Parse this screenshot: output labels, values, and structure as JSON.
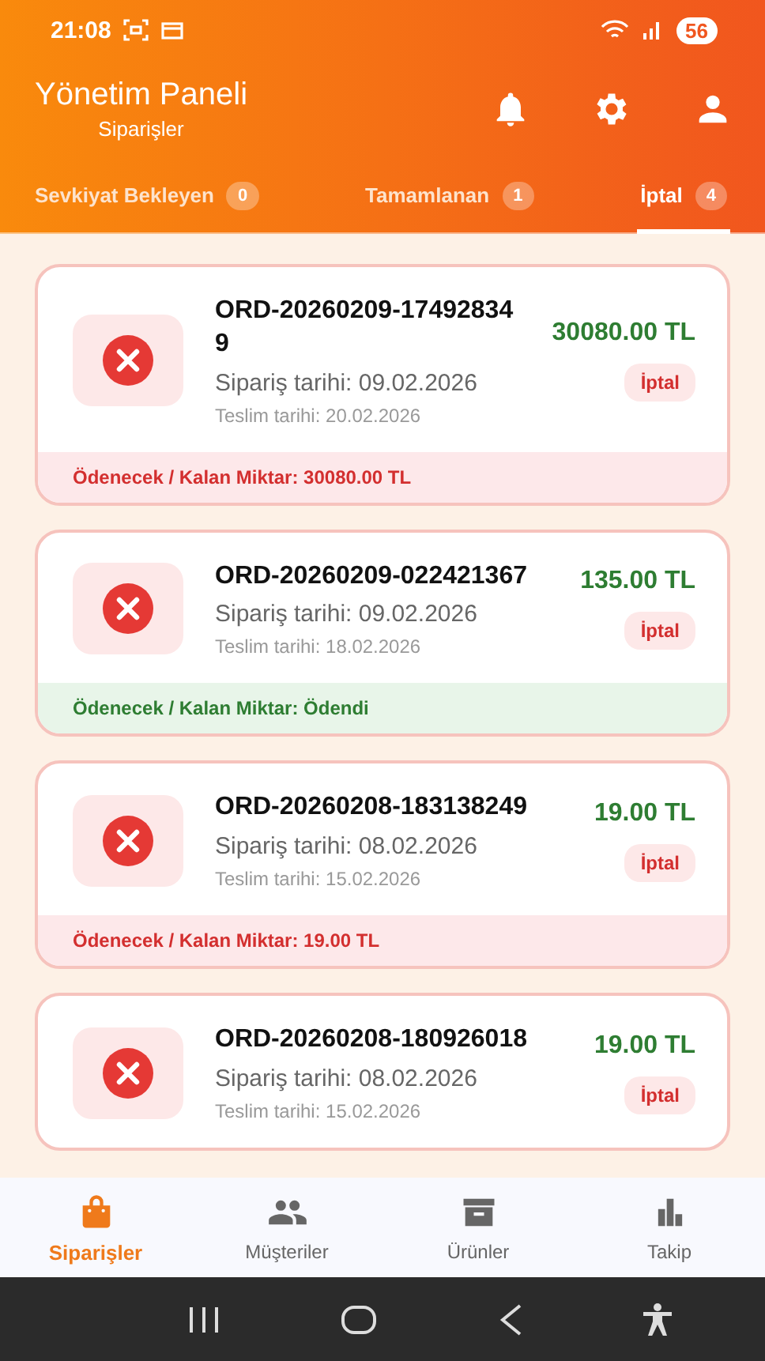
{
  "status_bar": {
    "time": "21:08",
    "battery": "56"
  },
  "header": {
    "title": "Yönetim Paneli",
    "subtitle": "Siparişler"
  },
  "tabs": [
    {
      "label": "Sevkiyat Bekleyen",
      "count": "0",
      "selected": false
    },
    {
      "label": "Tamamlanan",
      "count": "1",
      "selected": false
    },
    {
      "label": "İptal",
      "count": "4",
      "selected": true
    }
  ],
  "orders": [
    {
      "id": "ORD-20260209-174928349",
      "amount": "30080.00 TL",
      "status": "İptal",
      "order_date": "Sipariş tarihi: 09.02.2026",
      "delivery_date": "Teslim tarihi: 20.02.2026",
      "balance": "Ödenecek / Kalan Miktar: 30080.00 TL",
      "paid": false
    },
    {
      "id": "ORD-20260209-022421367",
      "amount": "135.00 TL",
      "status": "İptal",
      "order_date": "Sipariş tarihi: 09.02.2026",
      "delivery_date": "Teslim tarihi: 18.02.2026",
      "balance": "Ödenecek / Kalan Miktar: Ödendi",
      "paid": true
    },
    {
      "id": "ORD-20260208-183138249",
      "amount": "19.00 TL",
      "status": "İptal",
      "order_date": "Sipariş tarihi: 08.02.2026",
      "delivery_date": "Teslim tarihi: 15.02.2026",
      "balance": "Ödenecek / Kalan Miktar: 19.00 TL",
      "paid": false
    },
    {
      "id": "ORD-20260208-180926018",
      "amount": "19.00 TL",
      "status": "İptal",
      "order_date": "Sipariş tarihi: 08.02.2026",
      "delivery_date": "Teslim tarihi: 15.02.2026"
    }
  ],
  "bottom_nav": [
    {
      "label": "Siparişler",
      "selected": true
    },
    {
      "label": "Müşteriler",
      "selected": false
    },
    {
      "label": "Ürünler",
      "selected": false
    },
    {
      "label": "Takip",
      "selected": false
    }
  ]
}
